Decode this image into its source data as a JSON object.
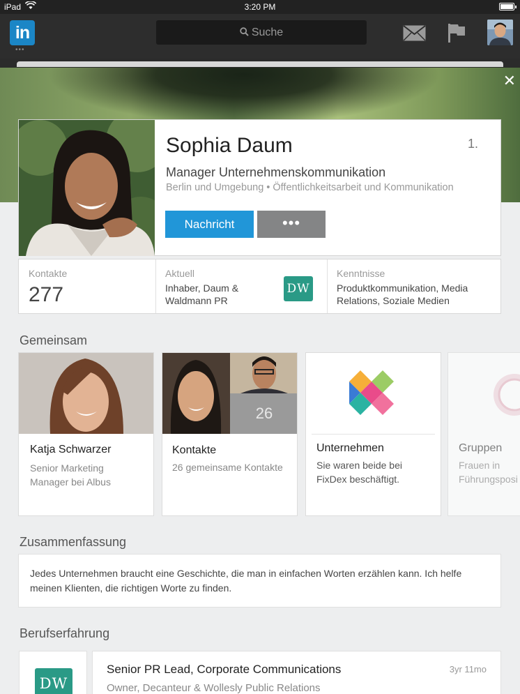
{
  "status_bar": {
    "device": "iPad",
    "time": "3:20 PM"
  },
  "nav": {
    "logo_text": "in",
    "logo_dots": "•••",
    "search_placeholder": "Suche",
    "icons": [
      "linkedin-logo",
      "search-icon",
      "mail-icon",
      "flag-icon",
      "user-avatar"
    ]
  },
  "close_label": "✕",
  "profile": {
    "name": "Sophia Daum",
    "degree": "1.",
    "headline": "Manager Unternehmenskommunikation",
    "location": "Berlin und Umgebung • Öffentlichkeitsarbeit und Kommunikation",
    "message_button": "Nachricht",
    "more_button": "•••"
  },
  "stats": {
    "contacts_label": "Kontakte",
    "contacts_count": "277",
    "current_label": "Aktuell",
    "current_text_line1": "Inhaber, Daum &",
    "current_text_line2": "Waldmann PR",
    "current_logo": "DW",
    "skills_label": "Kenntnisse",
    "skills_line1": "Produktkommunikation, Media",
    "skills_line2": "Relations, Soziale Medien"
  },
  "common": {
    "title": "Gemeinsam",
    "cards": [
      {
        "title": "Katja Schwarzer",
        "sub_line1": "Senior Marketing",
        "sub_line2": "Manager bei Albus"
      },
      {
        "title": "Kontakte",
        "sub_line1": "26 gemeinsame Kontakte",
        "count": "26"
      },
      {
        "title": "Unternehmen",
        "sub_line1": "Sie waren beide bei",
        "sub_line2": "FixDex beschäftigt."
      },
      {
        "title": "Gruppen",
        "sub_line1": "Frauen in",
        "sub_line2": "Führungsposi"
      }
    ]
  },
  "summary": {
    "title": "Zusammenfassung",
    "text_line1": "Jedes Unternehmen braucht eine Geschichte, die man in einfachen Worten erzählen kann. Ich helfe",
    "text_line2": "meinen Klienten, die richtigen Worte zu finden."
  },
  "experience": {
    "title": "Berufserfahrung",
    "items": [
      {
        "logo": "DW",
        "role": "Senior PR Lead, Corporate Communications",
        "company": "Owner, Decanteur & Wollesly Public Relations",
        "duration": "3yr 11mo"
      }
    ]
  },
  "colors": {
    "accent": "#2196d8",
    "brand": "#1b86c6",
    "dw_logo": "#2a9a86"
  }
}
